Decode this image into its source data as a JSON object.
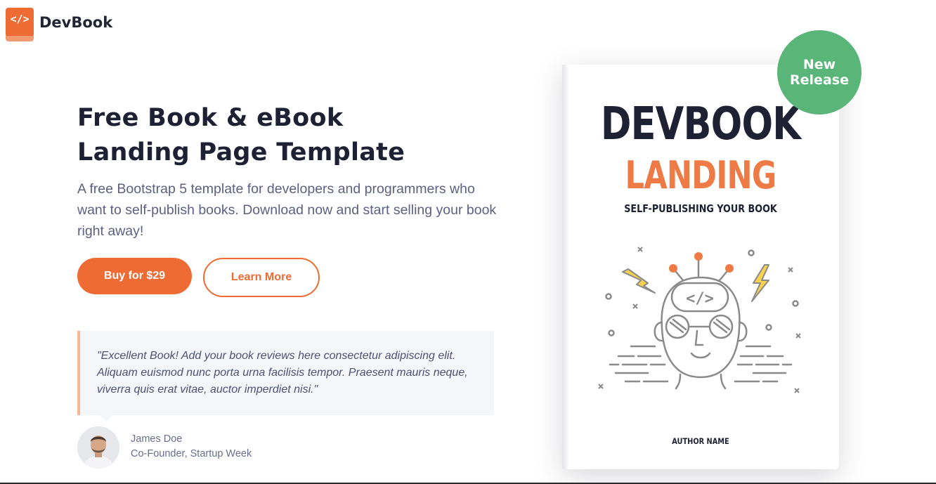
{
  "header": {
    "logo_glyph": "</>",
    "brand_name": "DevBook"
  },
  "hero": {
    "title_line1": "Free Book & eBook",
    "title_line2": "Landing Page Template",
    "description": "A free Bootstrap 5 template for developers and programmers who want to self-publish books. Download now and start selling your book right away!",
    "buy_button_label": "Buy for $29",
    "learn_more_label": "Learn More"
  },
  "testimonial": {
    "quote": "\"Excellent Book! Add your book reviews here consectetur adipiscing elit. Aliquam euismod nunc porta urna facilisis tempor. Praesent mauris neque, viverra quis erat vitae, auctor imperdiet nisi.\"",
    "name": "James Doe",
    "role": "Co-Founder, Startup Week"
  },
  "book": {
    "title": "DEVBOOK",
    "subtitle": "LANDING",
    "tagline": "SELF-PUBLISHING YOUR BOOK",
    "author": "AUTHOR NAME",
    "badge_line1": "New",
    "badge_line2": "Release",
    "illustration_glyph": "</>"
  },
  "colors": {
    "accent": "#EE6B34",
    "badge": "#5ab579",
    "text_dark": "#1e2033",
    "text_muted": "#5d6081"
  }
}
